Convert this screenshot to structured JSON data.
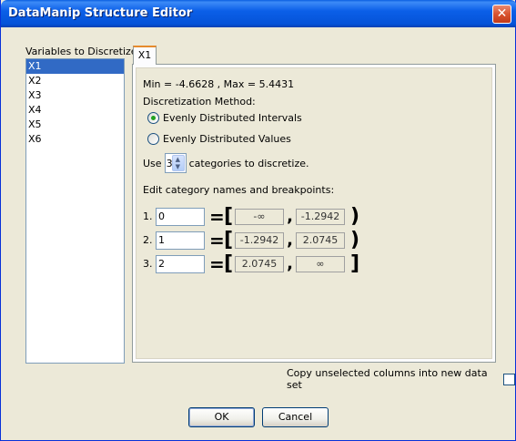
{
  "window": {
    "title": "DataManip Structure Editor",
    "close_glyph": "✕"
  },
  "variables": {
    "label": "Variables to Discretize:",
    "items": [
      "X1",
      "X2",
      "X3",
      "X4",
      "X5",
      "X6"
    ],
    "selected": "X1"
  },
  "tab": {
    "label": "X1"
  },
  "panel": {
    "minmax": "Min = -4.6628 , Max = 5.4431",
    "method_label": "Discretization Method:",
    "methods": [
      {
        "label": "Evenly Distributed Intervals",
        "checked": true
      },
      {
        "label": "Evenly Distributed Values",
        "checked": false
      }
    ],
    "use_prefix": "Use",
    "categories_value": "3",
    "use_suffix": "categories to discretize.",
    "edit_label": "Edit category names and breakpoints:",
    "rows": [
      {
        "num": "1.",
        "name": "0",
        "eq": "=",
        "open": "[",
        "low": "-∞",
        "comma": ",",
        "high": "-1.2942",
        "close": ")"
      },
      {
        "num": "2.",
        "name": "1",
        "eq": "=",
        "open": "[",
        "low": "-1.2942",
        "comma": ",",
        "high": "2.0745",
        "close": ")"
      },
      {
        "num": "3.",
        "name": "2",
        "eq": "=",
        "open": "[",
        "low": "2.0745",
        "comma": ",",
        "high": "∞",
        "close": "]"
      }
    ]
  },
  "copy_label": "Copy unselected columns into new data set",
  "buttons": {
    "ok": "OK",
    "cancel": "Cancel"
  },
  "colors": {
    "titlebar": "#0553d8",
    "selection": "#316ac5",
    "radio_dot": "#21a121",
    "tab_accent": "#e68b2c"
  }
}
